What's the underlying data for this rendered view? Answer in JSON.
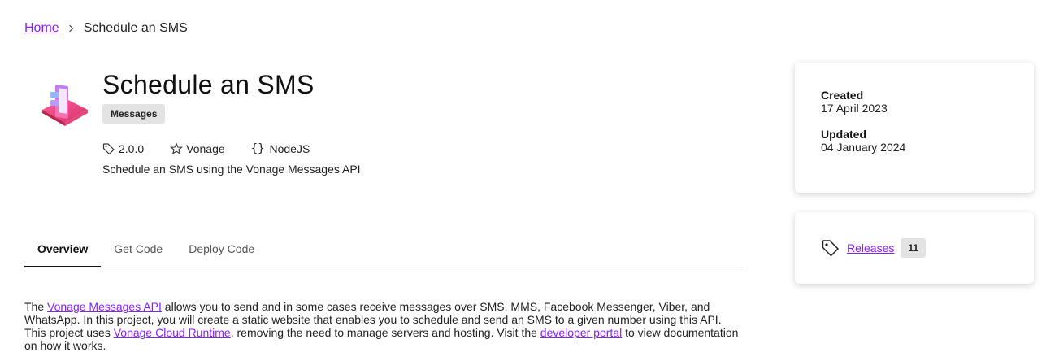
{
  "breadcrumb": {
    "home_label": "Home",
    "current_label": "Schedule an SMS"
  },
  "project": {
    "title": "Schedule an SMS",
    "category_badge": "Messages",
    "version": "2.0.0",
    "author": "Vonage",
    "language": "NodeJS",
    "description": "Schedule an SMS using the Vonage Messages API",
    "logo_icon": "phone-messages-logo"
  },
  "tabs": [
    {
      "label": "Overview",
      "active": true
    },
    {
      "label": "Get Code",
      "active": false
    },
    {
      "label": "Deploy Code",
      "active": false
    }
  ],
  "overview": {
    "t1": "The ",
    "link1": "Vonage Messages API",
    "t2": " allows you to send and in some cases receive messages over SMS, MMS, Facebook Messenger, Viber, and WhatsApp. In this project, you will create a static website that enables you to schedule and send an SMS to a given number using this API. This project uses ",
    "link2": "Vonage Cloud Runtime",
    "t3": ", removing the need to manage servers and hosting. Visit the ",
    "link3": "developer portal",
    "t4": " to view documentation on how it works."
  },
  "dates": {
    "created_label": "Created",
    "created_value": "17 April 2023",
    "updated_label": "Updated",
    "updated_value": "04 January 2024"
  },
  "releases": {
    "label": "Releases",
    "count": "11"
  },
  "colors": {
    "link": "#871fff",
    "badge_bg": "#e3e3e3"
  }
}
